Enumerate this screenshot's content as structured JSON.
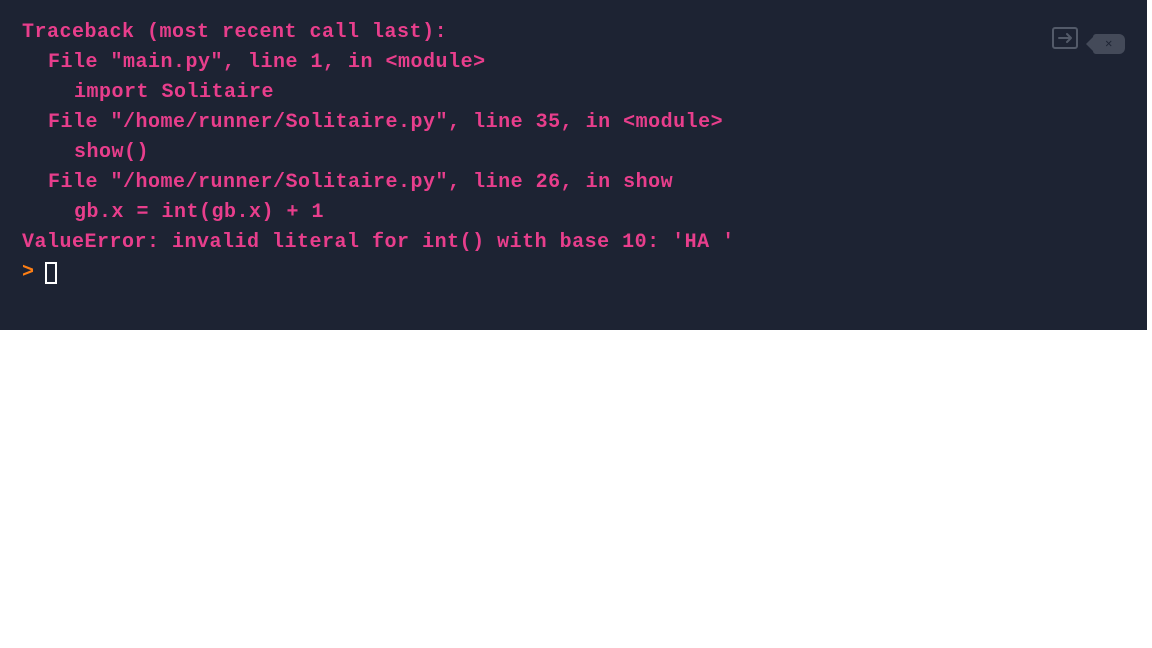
{
  "terminal": {
    "lines": [
      {
        "text": "Traceback (most recent call last):",
        "indent": 0
      },
      {
        "text": "File \"main.py\", line 1, in <module>",
        "indent": 1
      },
      {
        "text": "import Solitaire",
        "indent": 2
      },
      {
        "text": "File \"/home/runner/Solitaire.py\", line 35, in <module>",
        "indent": 1
      },
      {
        "text": "show()",
        "indent": 2
      },
      {
        "text": "File \"/home/runner/Solitaire.py\", line 26, in show",
        "indent": 1
      },
      {
        "text": "gb.x = int(gb.x) + 1",
        "indent": 2
      },
      {
        "text": "ValueError: invalid literal for int() with base 10: 'HA '",
        "indent": 0
      }
    ],
    "prompt": ">"
  },
  "toolbar": {
    "popout_label": "popout",
    "clear_label": "clear"
  }
}
